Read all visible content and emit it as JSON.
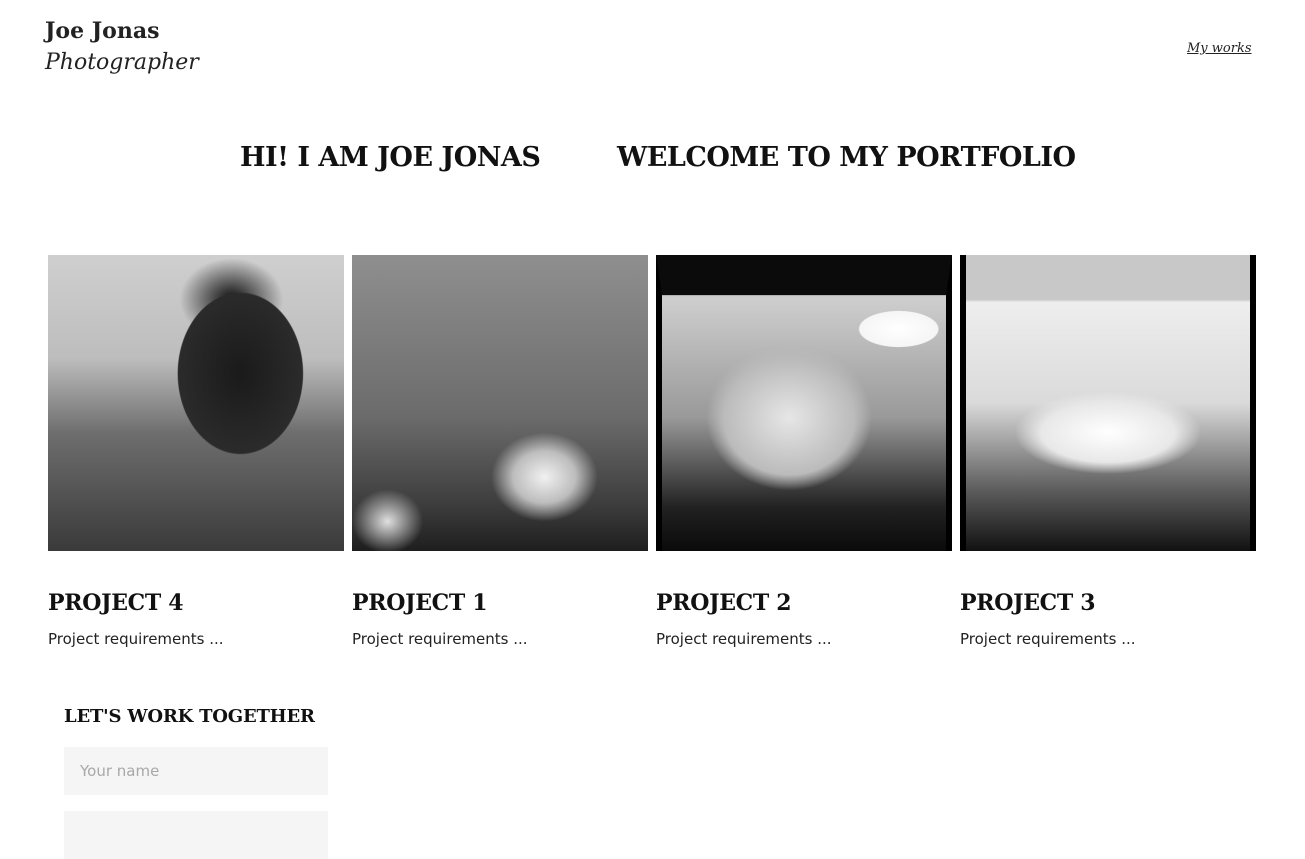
{
  "header": {
    "name": "Joe Jonas",
    "role": "Photographer",
    "nav_link": "My works"
  },
  "hero": {
    "left_text": "HI! I AM JOE JONAS",
    "right_text": "WELCOME TO MY PORTFOLIO"
  },
  "projects": [
    {
      "title": "PROJECT 4",
      "description": "Project requirements ..."
    },
    {
      "title": "PROJECT 1",
      "description": "Project requirements ..."
    },
    {
      "title": "PROJECT 2",
      "description": "Project requirements ..."
    },
    {
      "title": "PROJECT 3",
      "description": "Project requirements ..."
    }
  ],
  "contact": {
    "title": "LET'S WORK TOGETHER",
    "name_placeholder": "Your name",
    "second_value": ""
  }
}
